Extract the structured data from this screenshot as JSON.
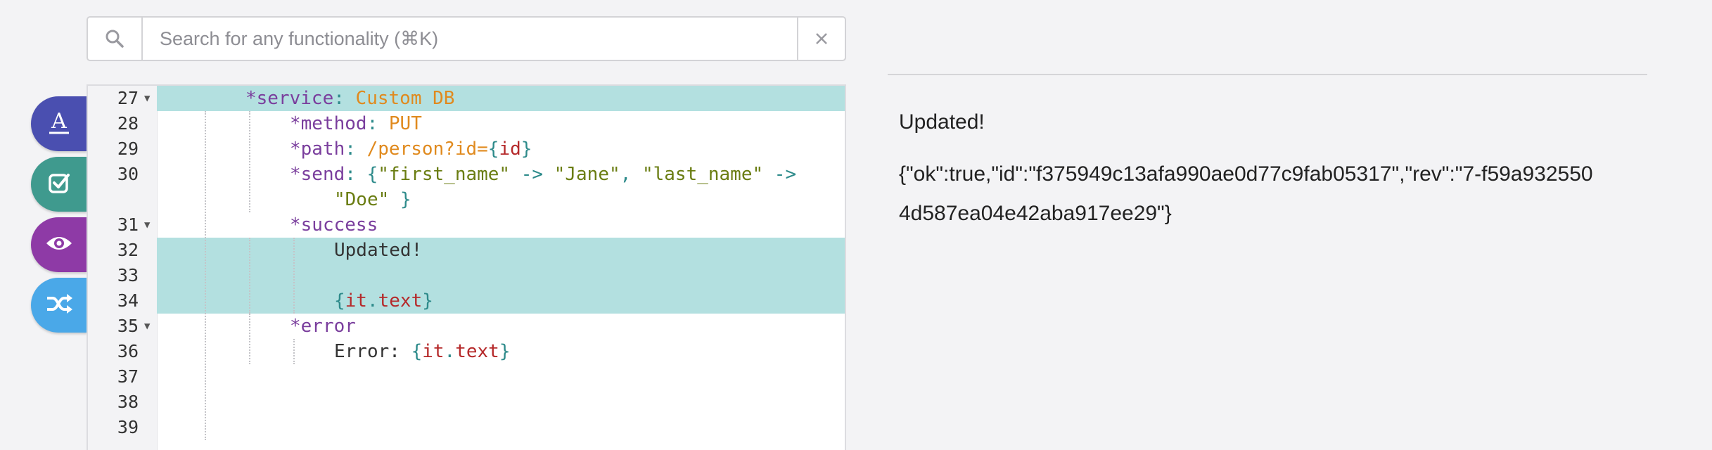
{
  "search": {
    "placeholder": "Search for any functionality (⌘K)",
    "icon": "search-icon",
    "clear_icon": "close-icon"
  },
  "toolbar": {
    "buttons": [
      {
        "name": "format",
        "icon": "text-format-icon",
        "color": "#4a4fb0"
      },
      {
        "name": "validate",
        "icon": "checkbox-icon",
        "color": "#3f9a8e"
      },
      {
        "name": "preview",
        "icon": "eye-icon",
        "color": "#8e3aa6"
      },
      {
        "name": "shuffle",
        "icon": "shuffle-icon",
        "color": "#4aa8e8"
      }
    ]
  },
  "editor": {
    "lines": [
      {
        "n": "27",
        "fold": true
      },
      {
        "n": "28"
      },
      {
        "n": "29"
      },
      {
        "n": "30"
      },
      {
        "n": ""
      },
      {
        "n": "31",
        "fold": true
      },
      {
        "n": "32"
      },
      {
        "n": "33"
      },
      {
        "n": "34"
      },
      {
        "n": "35",
        "fold": true
      },
      {
        "n": "36"
      },
      {
        "n": "37"
      },
      {
        "n": "38"
      },
      {
        "n": "39"
      }
    ],
    "tokens": {
      "service_key": "*service",
      "colon": ":",
      "service_val": "Custom DB",
      "method_key": "*method",
      "method_val": "PUT",
      "path_key": "*path",
      "path_val": "/person?id=",
      "brace_open": "{",
      "brace_close": "}",
      "id_var": "id",
      "send_key": "*send",
      "send_str1": "\"first_name\"",
      "arrow": "->",
      "send_str2": "\"Jane\"",
      "comma": ",",
      "send_str3": "\"last_name\"",
      "send_str4": "\"Doe\"",
      "success_key": "*success",
      "updated_text": "Updated!",
      "it": "it",
      "dot": ".",
      "text_prop": "text",
      "error_key": "*error",
      "error_text": "Error: "
    }
  },
  "result": {
    "title": "Updated!",
    "json": "{\"ok\":true,\"id\":\"f375949c13afa990ae0d77c9fab05317\",\"rev\":\"7-f59a9325504d587ea04e42aba917ee29\"}"
  },
  "colors": {
    "highlight": "#b3e0e0",
    "keyword": "#7a3e9d",
    "string_orange": "#e08a1e",
    "string_green": "#6a7d12",
    "variable": "#b5292a"
  }
}
